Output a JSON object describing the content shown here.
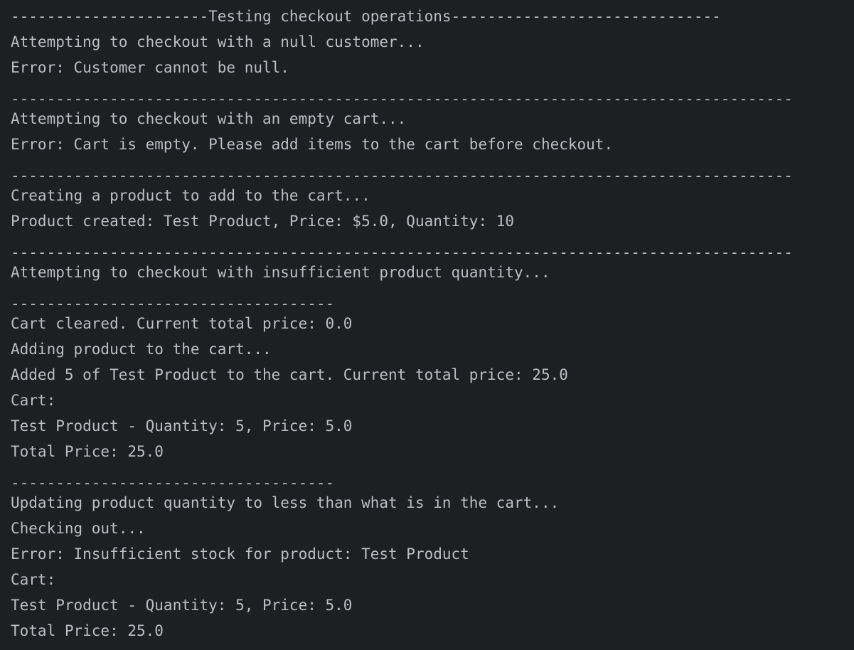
{
  "colors": {
    "background": "#1e1f22",
    "text": "#bcbec4"
  },
  "console": {
    "lines": [
      "----------------------Testing checkout operations------------------------------",
      "Attempting to checkout with a null customer...",
      "Error: Customer cannot be null.",
      "---------------------------------------------------------------------------------------",
      "Attempting to checkout with an empty cart...",
      "Error: Cart is empty. Please add items to the cart before checkout.",
      "---------------------------------------------------------------------------------------",
      "Creating a product to add to the cart...",
      "Product created: Test Product, Price: $5.0, Quantity: 10",
      "---------------------------------------------------------------------------------------",
      "Attempting to checkout with insufficient product quantity...",
      "------------------------------------",
      "Cart cleared. Current total price: 0.0",
      "Adding product to the cart...",
      "Added 5 of Test Product to the cart. Current total price: 25.0",
      "Cart:",
      "Test Product - Quantity: 5, Price: 5.0",
      "Total Price: 25.0",
      "------------------------------------",
      "Updating product quantity to less than what is in the cart...",
      "Checking out...",
      "Error: Insufficient stock for product: Test Product",
      "Cart:",
      "Test Product - Quantity: 5, Price: 5.0",
      "Total Price: 25.0"
    ]
  }
}
